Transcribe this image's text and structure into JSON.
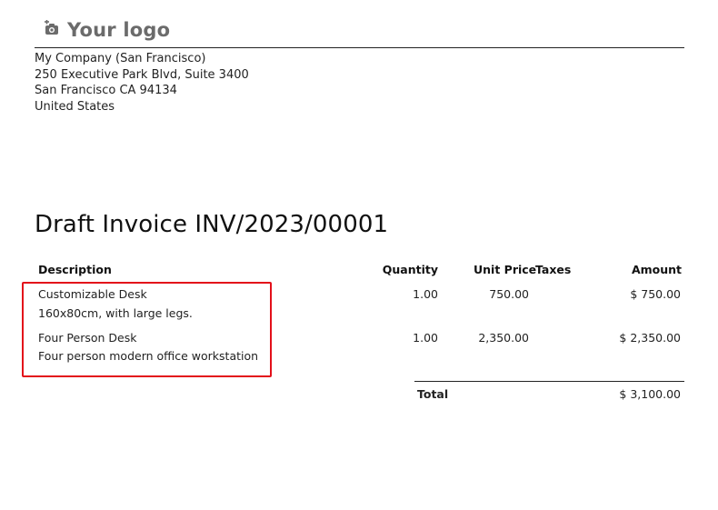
{
  "header": {
    "logo_text": "Your logo",
    "logo_icon": "camera-plus-icon"
  },
  "company": {
    "name": "My Company (San Francisco)",
    "street": "250 Executive Park Blvd, Suite 3400",
    "city": "San Francisco CA 94134",
    "country": "United States"
  },
  "invoice": {
    "title": "Draft Invoice INV/2023/00001"
  },
  "table": {
    "columns": {
      "description": "Description",
      "quantity": "Quantity",
      "unit_price": "Unit Price",
      "taxes": "Taxes",
      "amount": "Amount"
    },
    "rows": [
      {
        "name": "Customizable Desk",
        "detail": "160x80cm, with large legs.",
        "quantity": "1.00",
        "unit_price": "750.00",
        "amount": "$ 750.00"
      },
      {
        "name": "Four Person Desk",
        "detail": "Four person modern office workstation",
        "quantity": "1.00",
        "unit_price": "2,350.00",
        "amount": "$ 2,350.00"
      }
    ],
    "total_label": "Total",
    "total_amount": "$ 3,100.00"
  },
  "colors": {
    "highlight_border": "#e3101a",
    "logo_text": "#6b6b6b"
  }
}
